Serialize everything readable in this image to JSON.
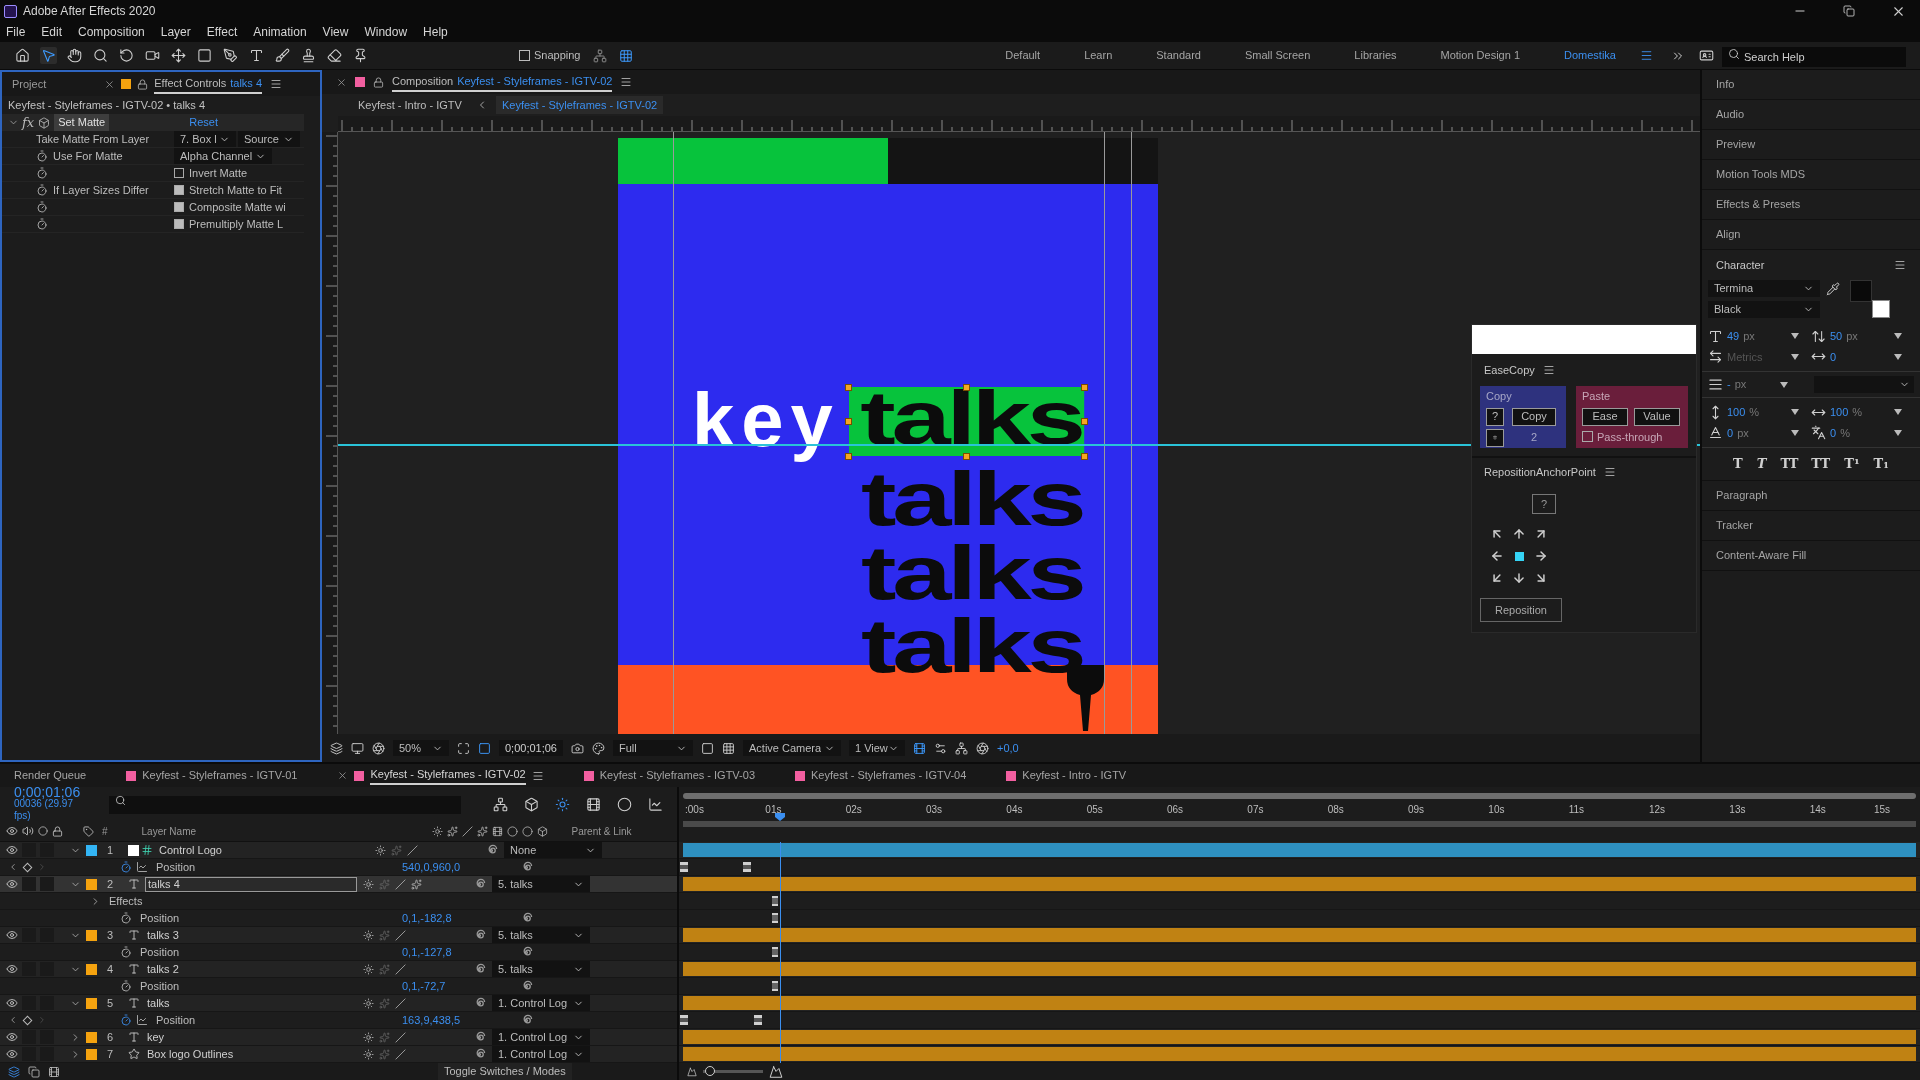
{
  "window": {
    "title": "Adobe After Effects 2020"
  },
  "menu": [
    "File",
    "Edit",
    "Composition",
    "Layer",
    "Effect",
    "Animation",
    "View",
    "Window",
    "Help"
  ],
  "tools": [
    {
      "selected": false
    },
    {
      "selected": true
    },
    {
      "selected": false
    },
    {
      "selected": false
    },
    {
      "selected": false
    },
    {
      "selected": false
    },
    {
      "selected": false
    },
    {
      "selected": false
    },
    {
      "selected": false
    },
    {
      "selected": false
    },
    {
      "selected": false
    },
    {
      "selected": false
    },
    {
      "selected": false
    },
    {
      "selected": false
    }
  ],
  "snapping": {
    "label": "Snapping",
    "checked": false
  },
  "workspaces": [
    {
      "label": "Default",
      "selected": false
    },
    {
      "label": "Learn",
      "selected": false
    },
    {
      "label": "Standard",
      "selected": false
    },
    {
      "label": "Small Screen",
      "selected": false
    },
    {
      "label": "Libraries",
      "selected": false
    },
    {
      "label": "Motion Design 1",
      "selected": false
    },
    {
      "label": "Domestika",
      "selected": true
    }
  ],
  "search_help": {
    "placeholder": "Search Help"
  },
  "left_panel": {
    "tabs": [
      {
        "label": "Project",
        "selected": false
      },
      {
        "label": "Effect Controls",
        "layer": "talks 4",
        "selected": true
      }
    ],
    "breadcrumb": "Keyfest - Styleframes - IGTV-02 • talks 4",
    "effect": {
      "badge": "fx",
      "name": "Set Matte",
      "reset": "Reset",
      "expanded": true
    },
    "params": [
      {
        "kind": "dropdowns",
        "label": "Take Matte From Layer",
        "stopwatch": false,
        "options": [
          "7. Box l",
          "Source"
        ]
      },
      {
        "kind": "dropdown",
        "label": "Use For Matte",
        "stopwatch": true,
        "value": "Alpha Channel"
      },
      {
        "kind": "checkbox",
        "stopwatch": true,
        "text": "Invert Matte",
        "checked": false
      },
      {
        "kind": "checkbox",
        "label": "If Layer Sizes Differ",
        "stopwatch": true,
        "text": "Stretch Matte to Fit",
        "checked": true
      },
      {
        "kind": "checkbox",
        "stopwatch": true,
        "text": "Composite Matte wi",
        "checked": true
      },
      {
        "kind": "checkbox",
        "stopwatch": true,
        "text": "Premultiply Matte L",
        "checked": true
      }
    ]
  },
  "viewer": {
    "tab": {
      "prefix": "Composition",
      "name": "Keyfest - Styleframes - IGTV-02",
      "selected": true
    },
    "breadcrumbs": [
      {
        "label": "Keyfest - Intro - IGTV",
        "selected": false
      },
      {
        "label": "Keyfest - Styleframes - IGTV-02",
        "selected": true
      }
    ],
    "comp": {
      "word": "key",
      "lines": [
        {
          "text": "talks",
          "selected": true
        },
        {
          "text": "talks",
          "selected": false
        },
        {
          "text": "talks",
          "selected": false
        },
        {
          "text": "talks",
          "selected": false
        }
      ]
    },
    "bottom_bar": {
      "zoom": "50%",
      "timecode": "0;00;01;06",
      "resolution": "Full",
      "camera": "Active Camera",
      "views": "1 View",
      "exposure": "+0,0"
    }
  },
  "ease_copy": {
    "title": "EaseCopy",
    "copy_group": {
      "legend": "Copy",
      "help": "?",
      "button": "Copy",
      "count": "2"
    },
    "paste_group": {
      "legend": "Paste",
      "buttons": [
        "Ease",
        "Value"
      ],
      "pass_through": {
        "label": "Pass-through",
        "checked": false
      }
    }
  },
  "reposition": {
    "title": "RepositionAnchorPoint",
    "help": "?",
    "anchors": [
      {
        "selected": false
      },
      {
        "selected": false
      },
      {
        "selected": false
      },
      {
        "selected": false
      },
      {
        "selected": true
      },
      {
        "selected": false
      },
      {
        "selected": false
      },
      {
        "selected": false
      },
      {
        "selected": false
      }
    ],
    "button": "Reposition"
  },
  "right_panels": [
    "Info",
    "Audio",
    "Preview",
    "Motion Tools MDS",
    "Effects & Presets",
    "Align"
  ],
  "character": {
    "title": "Character",
    "font": "Termina",
    "style": "Black",
    "metrics": [
      {
        "value": "49",
        "unit": "px",
        "muted": false
      },
      {
        "value": "50",
        "unit": "px",
        "muted": false
      },
      {
        "value": "Metrics",
        "muted": true
      },
      {
        "value": "0",
        "muted": false
      }
    ],
    "stroke": {
      "value": "-",
      "unit": "px"
    },
    "scales": [
      {
        "value": "100",
        "unit": "%"
      },
      {
        "value": "100",
        "unit": "%"
      },
      {
        "value": "0",
        "unit": "px"
      },
      {
        "value": "0",
        "unit": "%"
      }
    ],
    "styles": [
      {
        "glyph": "T",
        "kind": "bold"
      },
      {
        "glyph": "T",
        "kind": "italic"
      },
      {
        "glyph": "TT",
        "kind": "caps"
      },
      {
        "glyph": "TT",
        "kind": "smallcaps"
      },
      {
        "glyph": "T¹",
        "kind": "super"
      },
      {
        "glyph": "T₁",
        "kind": "sub"
      }
    ]
  },
  "collapsed_panels": [
    "Paragraph",
    "Tracker",
    "Content-Aware Fill"
  ],
  "timeline": {
    "tabs": [
      {
        "kind": "queue",
        "label": "Render Queue",
        "selected": false
      },
      {
        "kind": "comp",
        "label": "Keyfest - Styleframes - IGTV-01",
        "selected": false
      },
      {
        "kind": "comp",
        "label": "Keyfest - Styleframes - IGTV-02",
        "selected": true
      },
      {
        "kind": "comp",
        "label": "Keyfest - Styleframes - IGTV-03",
        "selected": false
      },
      {
        "kind": "comp",
        "label": "Keyfest - Styleframes - IGTV-04",
        "selected": false
      },
      {
        "kind": "comp",
        "label": "Keyfest - Intro - IGTV",
        "selected": false
      }
    ],
    "timecode": "0;00;01;06",
    "frames": "00036 (29.97 fps)",
    "columns": [
      "#",
      "Layer Name",
      "Parent & Link"
    ],
    "ruler": [
      ":00s",
      "01s",
      "02s",
      "03s",
      "04s",
      "05s",
      "06s",
      "07s",
      "08s",
      "09s",
      "10s",
      "11s",
      "12s",
      "13s",
      "14s",
      "15s"
    ],
    "playhead": {
      "level": 0.077
    },
    "rows": [
      {
        "kind": "null",
        "number": "1",
        "name": "Control Logo",
        "color": "#33b5f5",
        "expanded": true,
        "selected": false,
        "fx": false,
        "parent": "None"
      },
      {
        "kind": "property",
        "name": "Position",
        "value": "540,0,960,0",
        "animated": true
      },
      {
        "kind": "text",
        "number": "2",
        "name": "talks 4",
        "color": "#f5a30f",
        "expanded": true,
        "selected": true,
        "fx": true,
        "parent": "5. talks"
      },
      {
        "kind": "group",
        "name": "Effects",
        "expanded": false
      },
      {
        "kind": "property",
        "name": "Position",
        "value": "0,1,-182,8",
        "animated": false
      },
      {
        "kind": "text",
        "number": "3",
        "name": "talks 3",
        "color": "#f5a30f",
        "expanded": true,
        "selected": false,
        "fx": false,
        "parent": "5. talks"
      },
      {
        "kind": "property",
        "name": "Position",
        "value": "0,1,-127,8",
        "animated": false
      },
      {
        "kind": "text",
        "number": "4",
        "name": "talks 2",
        "color": "#f5a30f",
        "expanded": true,
        "selected": false,
        "fx": false,
        "parent": "5. talks"
      },
      {
        "kind": "property",
        "name": "Position",
        "value": "0,1,-72,7",
        "animated": false
      },
      {
        "kind": "text",
        "number": "5",
        "name": "talks",
        "color": "#f5a30f",
        "expanded": true,
        "selected": false,
        "fx": false,
        "parent": "1. Control Log"
      },
      {
        "kind": "property",
        "name": "Position",
        "value": "163,9,438,5",
        "animated": true
      },
      {
        "kind": "text",
        "number": "6",
        "name": "key",
        "color": "#f5a30f",
        "expanded": false,
        "selected": false,
        "fx": false,
        "parent": "1. Control Log"
      },
      {
        "kind": "shape",
        "number": "7",
        "name": "Box logo Outlines",
        "color": "#f5a30f",
        "expanded": false,
        "selected": false,
        "fx": false,
        "parent": "1. Control Log"
      }
    ],
    "footer": "Toggle Switches / Modes",
    "zoom": {
      "level": 0.12
    }
  }
}
